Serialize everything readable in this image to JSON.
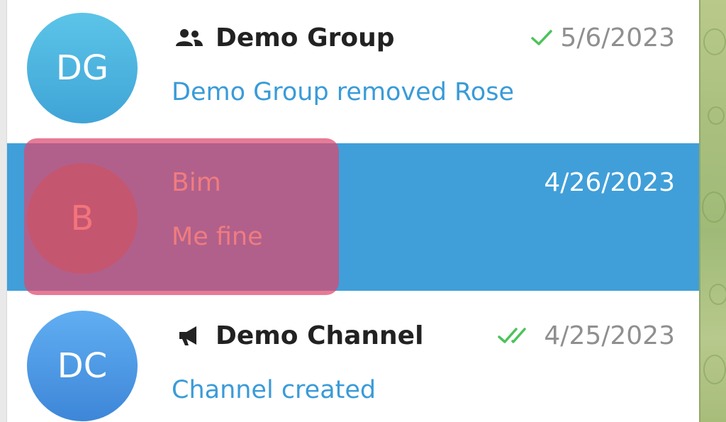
{
  "chats": [
    {
      "initials": "DG",
      "name": "Demo Group",
      "type_icon": "group-icon",
      "preview": "Demo Group removed Rose",
      "status_icon": "single-check-icon",
      "date": "5/6/2023"
    },
    {
      "initials": "B",
      "name": "Bim",
      "preview": "Me fine",
      "date": "4/26/2023",
      "selected": true
    },
    {
      "initials": "DC",
      "name": "Demo Channel",
      "type_icon": "channel-icon",
      "preview": "Channel created",
      "status_icon": "double-check-icon",
      "date": "4/25/2023"
    }
  ],
  "colors": {
    "selected_row": "#409fd9",
    "preview_text": "#3a9bd8",
    "highlight_overlay": "#dd486e",
    "check_green": "#4cc35a"
  }
}
